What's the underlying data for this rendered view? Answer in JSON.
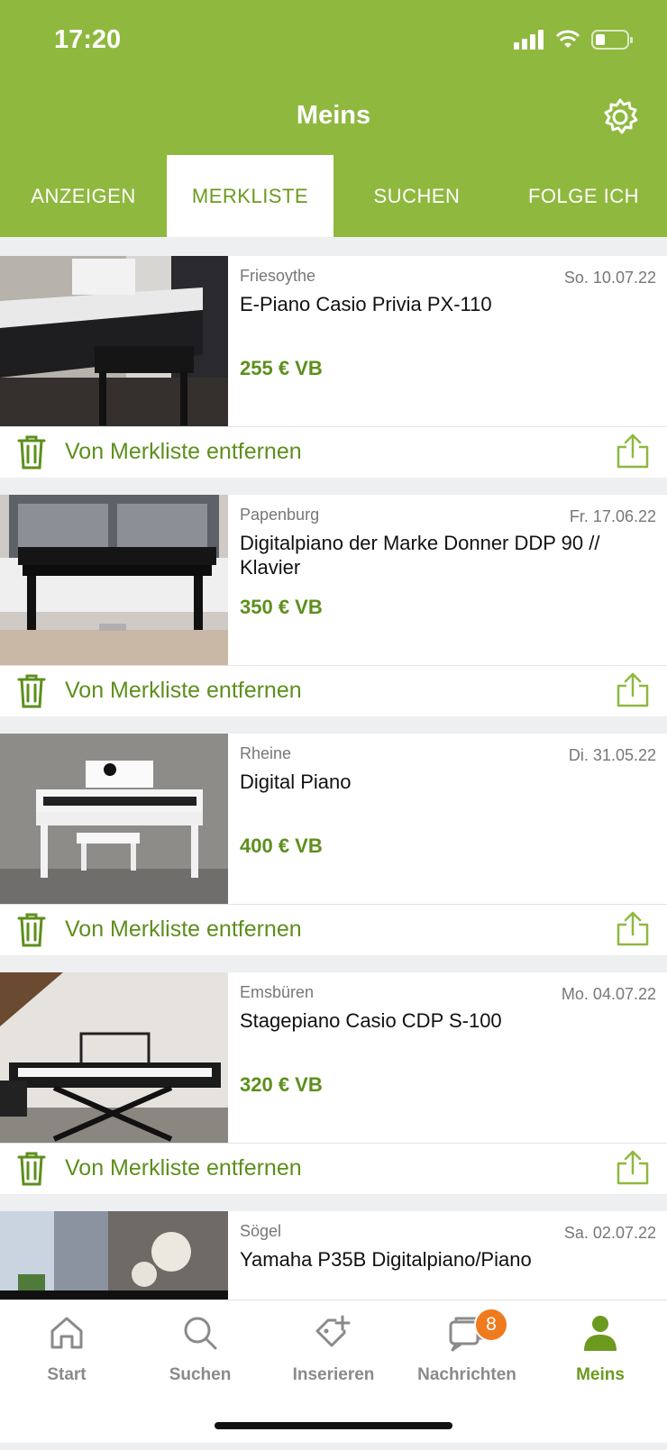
{
  "status": {
    "time": "17:20"
  },
  "header": {
    "title": "Meins"
  },
  "tabs": [
    {
      "label": "ANZEIGEN",
      "active": false
    },
    {
      "label": "MERKLISTE",
      "active": true
    },
    {
      "label": "SUCHEN",
      "active": false
    },
    {
      "label": "FOLGE ICH",
      "active": false
    }
  ],
  "items": [
    {
      "location": "Friesoythe",
      "date": "So. 10.07.22",
      "title": "E-Piano Casio Privia PX-110",
      "price": "255 € VB",
      "remove_label": "Von Merkliste entfernen"
    },
    {
      "location": "Papenburg",
      "date": "Fr. 17.06.22",
      "title": "Digitalpiano der Marke Donner DDP 90 // Klavier",
      "price": "350 € VB",
      "remove_label": "Von Merkliste entfernen"
    },
    {
      "location": "Rheine",
      "date": "Di. 31.05.22",
      "title": "Digital Piano",
      "price": "400 € VB",
      "remove_label": "Von Merkliste entfernen"
    },
    {
      "location": "Emsbüren",
      "date": "Mo. 04.07.22",
      "title": "Stagepiano Casio CDP S-100",
      "price": "320 € VB",
      "remove_label": "Von Merkliste entfernen"
    },
    {
      "location": "Sögel",
      "date": "Sa. 02.07.22",
      "title": "Yamaha P35B Digitalpiano/Piano",
      "price": "",
      "remove_label": ""
    }
  ],
  "nav": [
    {
      "label": "Start",
      "icon": "home-icon"
    },
    {
      "label": "Suchen",
      "icon": "search-icon"
    },
    {
      "label": "Inserieren",
      "icon": "tag-plus-icon"
    },
    {
      "label": "Nachrichten",
      "icon": "chat-icon",
      "badge": "8"
    },
    {
      "label": "Meins",
      "icon": "user-icon",
      "active": true
    }
  ],
  "colors": {
    "brand": "#8fb83f",
    "price": "#5d8f1c",
    "badge": "#f07a1e"
  }
}
